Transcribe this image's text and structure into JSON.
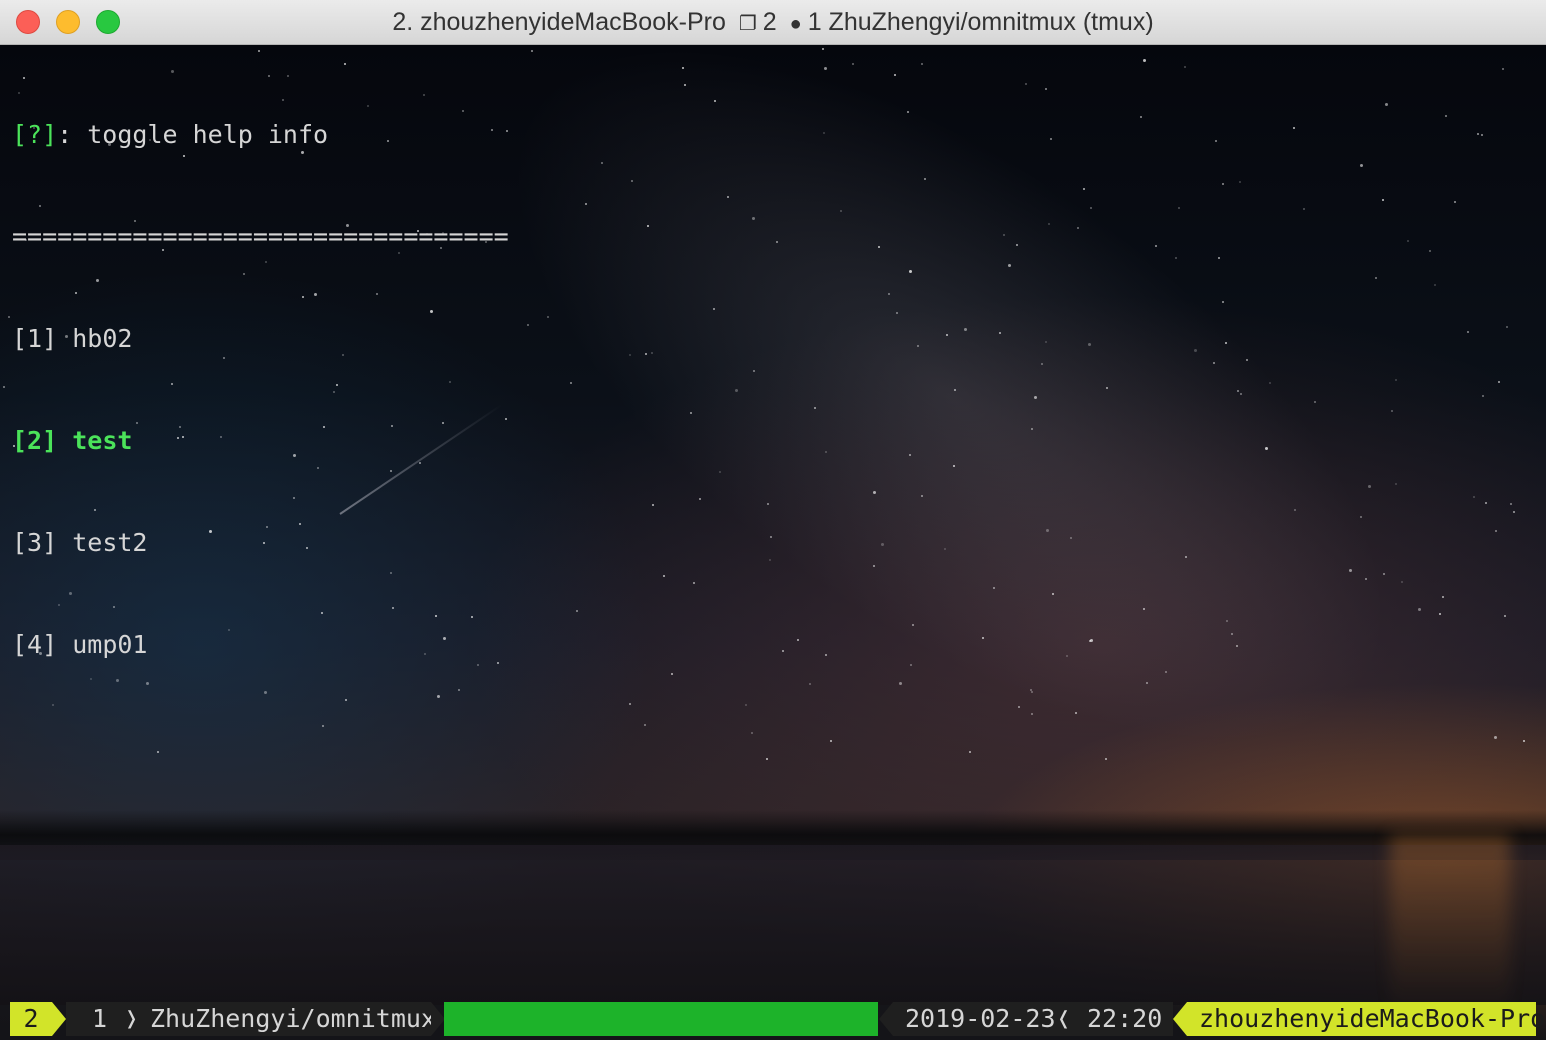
{
  "window": {
    "title_prefix": "2. zhouzhenyideMacBook-Pro",
    "title_icon": "❐",
    "title_count": "2",
    "title_dot": "●",
    "title_suffix": "1 ZhuZhengyi/omnitmux (tmux)",
    "buttons": {
      "close": "close",
      "minimize": "minimize",
      "zoom": "zoom"
    }
  },
  "terminal": {
    "help_key": "[?]",
    "help_text": ": toggle help info",
    "separator": "=================================",
    "sessions": [
      {
        "index": "[1]",
        "name": "hb02",
        "selected": false
      },
      {
        "index": "[2]",
        "name": "test",
        "selected": true
      },
      {
        "index": "[3]",
        "name": "test2",
        "selected": false
      },
      {
        "index": "[4]",
        "name": "ump01",
        "selected": false
      }
    ]
  },
  "statusbar": {
    "session_number": "2",
    "window_index": "1",
    "chevron_right": "❭",
    "window_name": "ZhuZhengyi/omnitmux",
    "date": "2019-02-23",
    "chevron_left": "❬",
    "time": "22:20",
    "hostname": "zhouzhenyideMacBook-Pro"
  },
  "colors": {
    "accent_green": "#4be35a",
    "status_yellow": "#d2e429",
    "status_green": "#1db32a",
    "status_dark": "#1f1f1f"
  }
}
